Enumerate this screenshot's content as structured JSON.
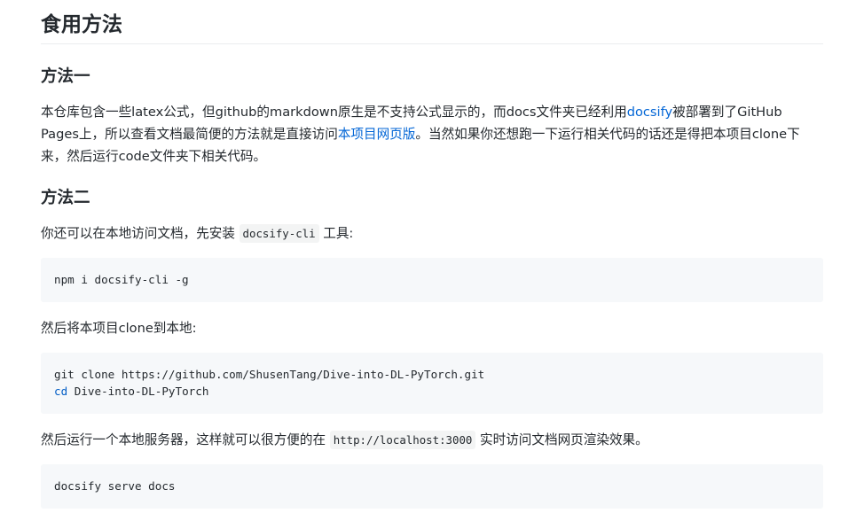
{
  "heading_main": "食用方法",
  "method1": {
    "title": "方法一",
    "p_part1": "本仓库包含一些latex公式，但github的markdown原生是不支持公式显示的，而docs文件夹已经利用",
    "link_docsify": "docsify",
    "p_part2": "被部署到了GitHub Pages上，所以查看文档最简便的方法就是直接访问",
    "link_web": "本项目网页版",
    "p_part3": "。当然如果你还想跑一下运行相关代码的话还是得把本项目clone下来，然后运行code文件夹下相关代码。"
  },
  "method2": {
    "title": "方法二",
    "p1_before": "你还可以在本地访问文档，先安装 ",
    "p1_code": "docsify-cli",
    "p1_after": " 工具:",
    "code1": "npm i docsify-cli -g",
    "p2": "然后将本项目clone到本地:",
    "code2_line1": "git clone https://github.com/ShusenTang/Dive-into-DL-PyTorch.git",
    "code2_line2_kw": "cd",
    "code2_line2_rest": " Dive-into-DL-PyTorch",
    "p3_before": "然后运行一个本地服务器，这样就可以很方便的在 ",
    "p3_code": "http://localhost:3000",
    "p3_after": " 实时访问文档网页渲染效果。",
    "code3": "docsify serve docs"
  },
  "colors": {
    "link": "#0366d6",
    "code_bg": "#f6f8fa",
    "text": "#24292e",
    "keyword": "#005cc5"
  }
}
